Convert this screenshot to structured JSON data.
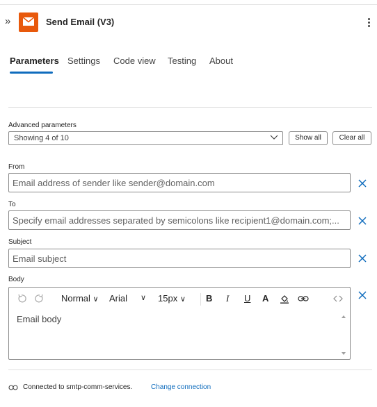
{
  "header": {
    "title": "Send Email (V3)",
    "icon": "email-icon",
    "accent_color": "#e8590c"
  },
  "tabs": [
    {
      "label": "Parameters",
      "active": true
    },
    {
      "label": "Settings",
      "active": false
    },
    {
      "label": "Code view",
      "active": false
    },
    {
      "label": "Testing",
      "active": false
    },
    {
      "label": "About",
      "active": false
    }
  ],
  "advanced": {
    "label": "Advanced parameters",
    "select_value": "Showing 4 of 10",
    "show_all": "Show all",
    "clear_all": "Clear all"
  },
  "fields": {
    "from": {
      "label": "From",
      "placeholder": "Email address of sender like sender@domain.com"
    },
    "to": {
      "label": "To",
      "placeholder": "Specify email addresses separated by semicolons like recipient1@domain.com;..."
    },
    "subject": {
      "label": "Subject",
      "placeholder": "Email subject"
    },
    "body": {
      "label": "Body",
      "placeholder": "Email body"
    }
  },
  "editor_toolbar": {
    "style": "Normal",
    "font": "Arial",
    "size": "15px",
    "bold": "B",
    "italic": "I",
    "underline": "U",
    "font_color": "A"
  },
  "footer": {
    "connection_text": "Connected to smtp-comm-services.",
    "change_link": "Change connection"
  },
  "link_color": "#0f6cbd"
}
